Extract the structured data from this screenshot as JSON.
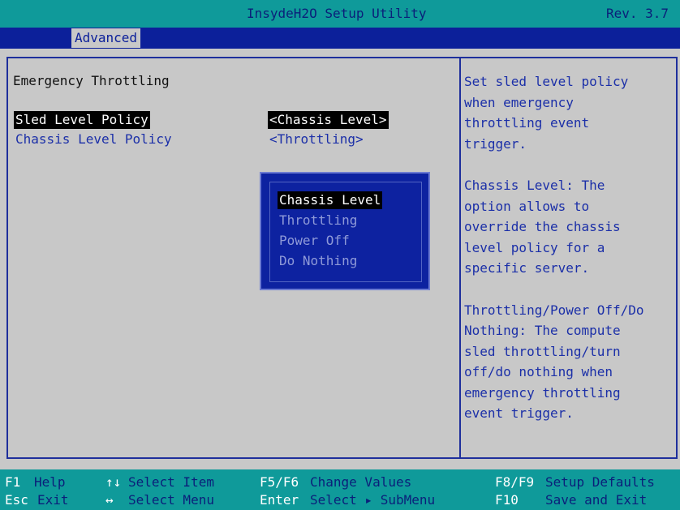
{
  "header": {
    "app_title": "InsydeH2O Setup Utility",
    "revision": "Rev. 3.7"
  },
  "menu": {
    "active_tab": "Advanced"
  },
  "page": {
    "section_title": "Emergency Throttling",
    "options": [
      {
        "label": "Sled Level Policy",
        "value": "<Chassis Level>"
      },
      {
        "label": "Chassis Level Policy",
        "value": "<Throttling>"
      }
    ]
  },
  "popup": {
    "items": [
      "Chassis Level",
      "Throttling",
      "Power Off",
      "Do Nothing"
    ],
    "selected": "Chassis Level"
  },
  "help": {
    "lines": [
      "Set sled level policy",
      "when emergency",
      "throttling event",
      "trigger.",
      "Chassis Level: The",
      "option allows to",
      "override the chassis",
      "level policy for a",
      "specific server.",
      "Throttling/Power Off/Do",
      "Nothing: The compute",
      "sled throttling/turn",
      "off/do nothing when",
      "emergency throttling",
      "event trigger."
    ]
  },
  "footer": {
    "row1": [
      {
        "key": "F1",
        "action": "Help"
      },
      {
        "key": "↑↓",
        "action": "Select Item"
      },
      {
        "key": "F5/F6",
        "action": "Change Values"
      },
      {
        "key": "F8/F9",
        "action": "Setup Defaults"
      }
    ],
    "row2": [
      {
        "key": "Esc",
        "action": "Exit"
      },
      {
        "key": "↔",
        "action": "Select Menu"
      },
      {
        "key": "Enter",
        "action": "Select ▸ SubMenu"
      },
      {
        "key": "F10",
        "action": "Save and Exit"
      }
    ]
  },
  "colors": {
    "title_bar": "#0f9a9a",
    "menu_bar": "#0c209a",
    "background": "#c8c8c8",
    "text_blue": "#1b2fa8",
    "popup_bg": "#0d22a0"
  }
}
